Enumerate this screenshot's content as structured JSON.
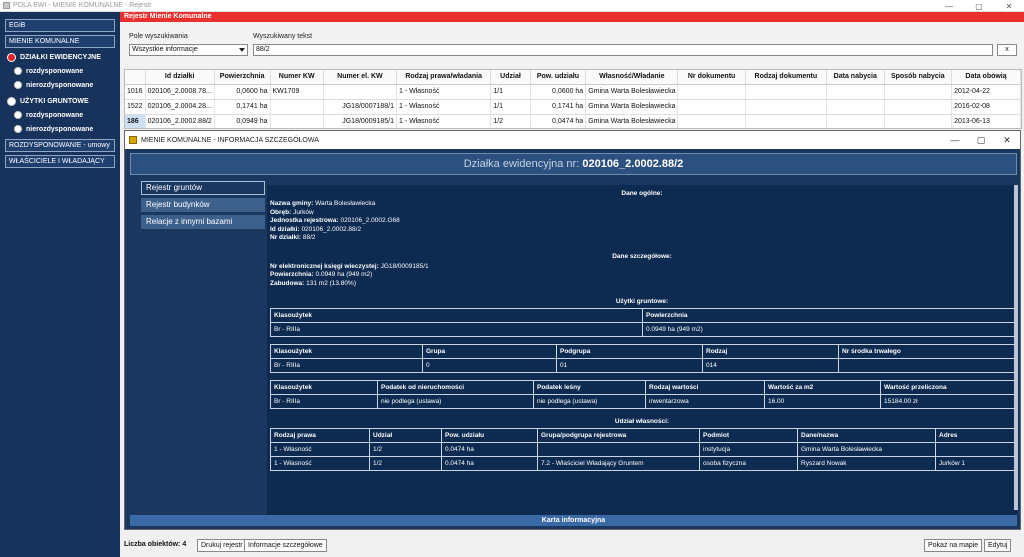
{
  "window": {
    "title": "POLA EWI - MIENIE KOMUNALNE - Rejestr",
    "min": "—",
    "max": "▢",
    "close": "✕"
  },
  "sidebar": {
    "egib": "EGiB",
    "mienie": "MIENIE KOMUNALNE",
    "dzialki": "DZIAŁKI EWIDENCYJNE",
    "rozdysponowane1": "rozdysponowane",
    "nierozdysponowane1": "nierozdysponowane",
    "uzytki": "UŻYTKI GRUNTOWE",
    "rozdysponowane2": "rozdysponowane",
    "nierozdysponowane2": "nierozdysponowane",
    "umowy": "ROZDYSPONOWANIE - umowy",
    "wlasciciele": "WŁAŚCICIELE I WŁADAJĄCY"
  },
  "header": {
    "title": "Rejestr Mienie Komunalne"
  },
  "search": {
    "field_label": "Pole wyszukiwania",
    "field_value": "Wszystkie informacje",
    "text_label": "Wyszukiwany tekst",
    "text_value": "88/2",
    "clear_label": "x"
  },
  "grid": {
    "columns": [
      "",
      "Id działki",
      "Powierzchnia",
      "Numer KW",
      "Numer el. KW",
      "Rodzaj prawa/władania",
      "Udział",
      "Pow. udziału",
      "Własność/Władanie",
      "Nr dokumentu",
      "Rodzaj dokumentu",
      "Data nabycia",
      "Sposób nabycia",
      "Data obowią"
    ],
    "rows": [
      [
        "1016",
        "020106_2.0008.78...",
        "0,0600 ha",
        "KW1709",
        "",
        "1 - Własność",
        "1/1",
        "0,0600 ha",
        "Gmina Warta Bolesławiecka",
        "",
        "",
        "",
        "",
        "2012-04-22"
      ],
      [
        "1522",
        "020106_2.0004.28...",
        "0,1741 ha",
        "",
        "JG18/0007188/1",
        "1 - Własność",
        "1/1",
        "0,1741 ha",
        "Gmina Warta Bolesławiecka",
        "",
        "",
        "",
        "",
        "2016-02-08"
      ],
      [
        "186",
        "020106_2.0002.88/2",
        "0,0949 ha",
        "",
        "JG18/0009185/1",
        "1 - Własność",
        "1/2",
        "0,0474 ha",
        "Gmina Warta Bolesławiecka",
        "",
        "",
        "",
        "",
        "2013-06-13"
      ]
    ]
  },
  "detail": {
    "title": "MIENIE KOMUNALNE - INFORMACJA SZCZEGÓŁOWA",
    "heading_prefix": "Działka ewidencyjna nr:",
    "heading_value": "020106_2.0002.88/2",
    "tabs": [
      "Rejestr gruntów",
      "Rejestr budynków",
      "Relacje z innymi bazami"
    ],
    "dane_ogolne": "Dane ogólne:",
    "general": [
      {
        "k": "Nazwa gminy:",
        "v": "Warta Bolesławiecka"
      },
      {
        "k": "Obręb:",
        "v": "Jurków"
      },
      {
        "k": "Jednostka rejestrowa:",
        "v": "020106_2.0002.G68"
      },
      {
        "k": "Id działki:",
        "v": "020106_2.0002.88/2"
      },
      {
        "k": "Nr działki:",
        "v": "88/2"
      }
    ],
    "dane_szczegolowe": "Dane szczegółowe:",
    "detailed": [
      {
        "k": "Nr elektronicznej księgi wieczystej:",
        "v": "JG18/0009185/1"
      },
      {
        "k": "Powierzchnia:",
        "v": "0.0949 ha (949 m2)"
      },
      {
        "k": "Zabudowa:",
        "v": "131 m2 (13.80%)"
      }
    ],
    "uzytki_title": "Użytki gruntowe:",
    "t1": {
      "h": [
        "Klasoużytek",
        "Powierzchnia"
      ],
      "r": [
        "Br - RIIIa",
        "0.0949 ha (949 m2)"
      ]
    },
    "t2": {
      "h": [
        "Klasoużytek",
        "Grupa",
        "Podgrupa",
        "Rodzaj",
        "Nr środka trwałego"
      ],
      "r": [
        "Br - RIIIa",
        "0",
        "01",
        "014",
        ""
      ]
    },
    "t3": {
      "h": [
        "Klasoużytek",
        "Podatek od nieruchomości",
        "Podatek leśny",
        "Rodzaj wartości",
        "Wartość za m2",
        "Wartość przeliczona"
      ],
      "r": [
        "Br - RIIIa",
        "nie podlega (ustawa)",
        "nie podlega (ustawa)",
        "inwentarzowa",
        "16.00",
        "15184.00 zł"
      ]
    },
    "udzial_title": "Udział własności:",
    "t4": {
      "h": [
        "Rodzaj prawa",
        "Udział",
        "Pow. udziału",
        "Grupa/podgrupa rejestrowa",
        "Podmiot",
        "Dane/nazwa",
        "Adres"
      ],
      "rows": [
        [
          "1 - Własność",
          "1/2",
          "0.0474 ha",
          "",
          "instytucja",
          "Gmina Warta Bolesławiecka",
          ""
        ],
        [
          "1 - Własność",
          "1/2",
          "0.0474 ha",
          "7.2 - Właściciel Władający Gruntem",
          "osoba fizyczna",
          "Ryszard Nowak",
          "Jurków 1"
        ]
      ]
    },
    "karta": "Karta informacyjna"
  },
  "bottom": {
    "count": "Liczba obiektów: 4",
    "drukuj": "Drukuj rejestr",
    "info": "Informacje szczegółowe",
    "mapa": "Pokaż na mapie",
    "edytuj": "Edytuj"
  }
}
